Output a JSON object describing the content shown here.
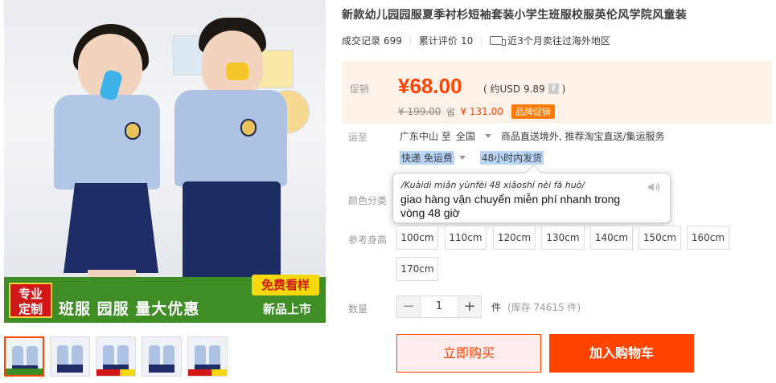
{
  "gallery": {
    "banner": {
      "corner_tag": "专业\n定制",
      "text": "班服 园服 量大优惠",
      "free_sample": "免费看样",
      "new_listing": "新品上市"
    },
    "thumb_count": 5
  },
  "product": {
    "title": "新款幼儿园园服夏季衬杉短袖套装小学生班服校服英伦风学院风童装",
    "sales_label": "成交记录",
    "sales_count": "699",
    "reviews_label": "累计评价",
    "reviews_count": "10",
    "overseas_text": "近3个月卖往过海外地区"
  },
  "price": {
    "label": "促销",
    "current": "¥68.00",
    "usd": "( 约USD 9.89",
    "usd_q": "?",
    "usd_close": ")",
    "original": "¥ 199.00",
    "save_label": "省",
    "save_amount": "¥ 131.00",
    "promo_badge": "品牌促销"
  },
  "shipping": {
    "label": "运至",
    "from": "广东中山 至",
    "to": "全国",
    "service": "商品直送境外, 推荐淘宝直送/集运服务",
    "express": "快递 免运费",
    "dispatch": "48小时内发货"
  },
  "popup": {
    "pinyin": "/Kuàidì miǎn yùnfèi 48 xiǎoshí nèi fā huò/",
    "translation": "giao hàng vận chuyển miễn phí nhanh trong vòng 48 giờ"
  },
  "color_label": "颜色分类",
  "size": {
    "label": "参考身高",
    "options": [
      "100cm",
      "110cm",
      "120cm",
      "130cm",
      "140cm",
      "150cm",
      "160cm",
      "170cm"
    ]
  },
  "quantity": {
    "label": "数量",
    "minus": "−",
    "value": "1",
    "plus": "+",
    "unit": "件",
    "stock": "(库存 74615 件)"
  },
  "actions": {
    "buy_now": "立即购买",
    "add_to_cart": "加入购物车"
  },
  "colors": {
    "accent": "#ff4400",
    "price_bg": "#fff2e8",
    "promo": "#ff7a00"
  }
}
